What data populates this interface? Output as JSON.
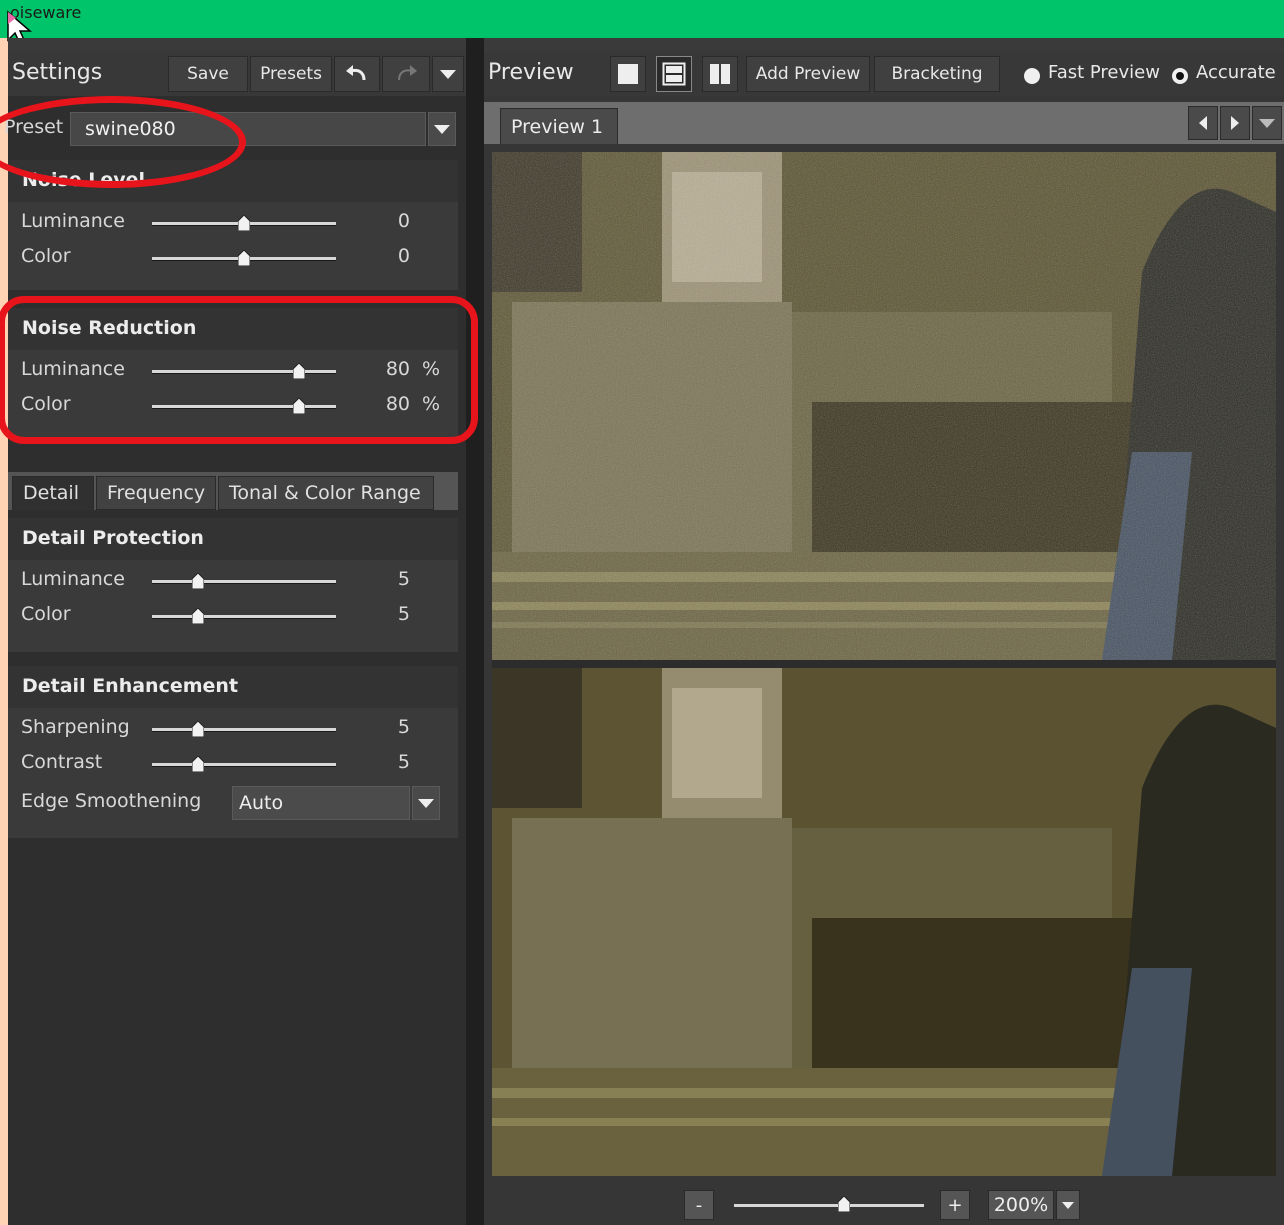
{
  "window": {
    "title": "oiseware"
  },
  "settings": {
    "title": "Settings",
    "save_label": "Save",
    "presets_label": "Presets",
    "preset_label": "Preset",
    "preset_value": "swine080"
  },
  "noise_level": {
    "title": "Noise Level",
    "luminance": {
      "label": "Luminance",
      "value": "0",
      "level": 0.5
    },
    "color": {
      "label": "Color",
      "value": "0",
      "level": 0.5
    }
  },
  "noise_reduction": {
    "title": "Noise Reduction",
    "luminance": {
      "label": "Luminance",
      "value": "80",
      "unit": "%",
      "level": 0.8
    },
    "color": {
      "label": "Color",
      "value": "80",
      "unit": "%",
      "level": 0.8
    }
  },
  "tabs": [
    "Detail",
    "Frequency",
    "Tonal & Color Range"
  ],
  "detail_protection": {
    "title": "Detail Protection",
    "luminance": {
      "label": "Luminance",
      "value": "5",
      "level": 0.25
    },
    "color": {
      "label": "Color",
      "value": "5",
      "level": 0.25
    }
  },
  "detail_enhancement": {
    "title": "Detail Enhancement",
    "sharpening": {
      "label": "Sharpening",
      "value": "5",
      "level": 0.25
    },
    "contrast": {
      "label": "Contrast",
      "value": "5",
      "level": 0.25
    },
    "edge_smoothening": {
      "label": "Edge Smoothening",
      "value": "Auto"
    }
  },
  "preview": {
    "title": "Preview",
    "add_preview_label": "Add Preview",
    "bracketing_label": "Bracketing",
    "fast_preview_label": "Fast Preview",
    "accurate_label": "Accurate",
    "tab_label": "Preview 1",
    "zoom_minus": "-",
    "zoom_plus": "+",
    "zoom_value": "200%",
    "zoom_level": 0.58
  },
  "colors": {
    "titlebar": "#00c46a",
    "annotation": "#e8141b",
    "panel": "#2e2e2e"
  }
}
